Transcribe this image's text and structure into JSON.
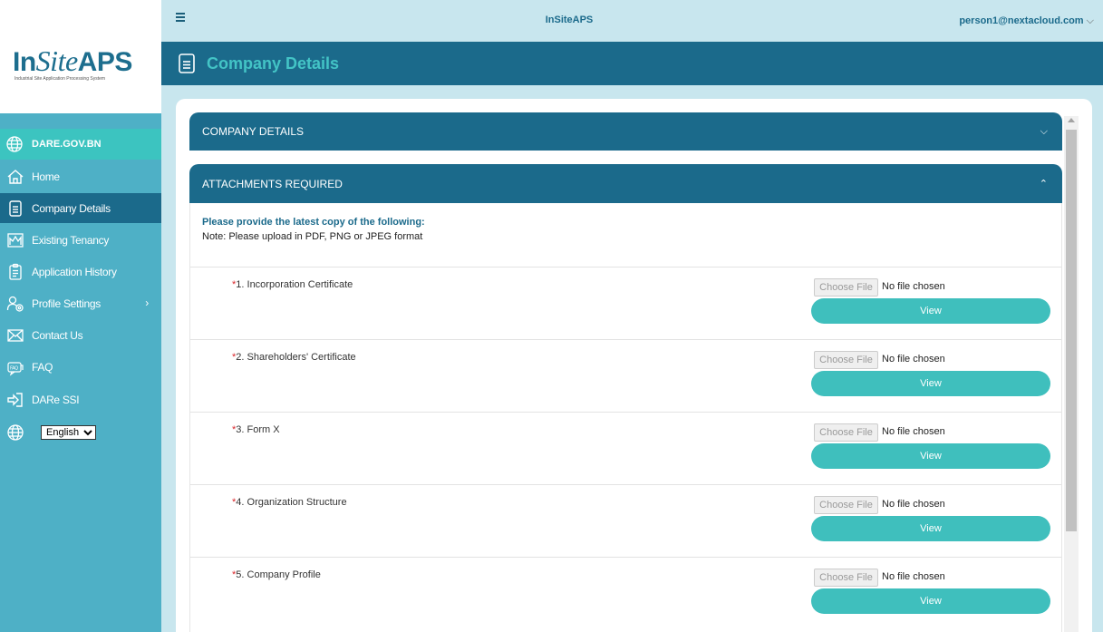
{
  "app": {
    "logo_in": "In",
    "logo_site": "Site",
    "logo_aps": "APS",
    "logo_subtitle": "Industrial Site Application Processing System",
    "top_title": "InSiteAPS",
    "user": "person1@nextacloud.com"
  },
  "sidebar": {
    "domain": "DARE.GOV.BN",
    "items": [
      {
        "label": "Home",
        "icon": "home-icon"
      },
      {
        "label": "Company Details",
        "icon": "document-icon"
      },
      {
        "label": "Existing Tenancy",
        "icon": "building-icon"
      },
      {
        "label": "Application History",
        "icon": "clipboard-icon"
      },
      {
        "label": "Profile Settings",
        "icon": "users-gear-icon"
      },
      {
        "label": "Contact Us",
        "icon": "envelope-icon"
      },
      {
        "label": "FAQ",
        "icon": "faq-icon"
      },
      {
        "label": "DARe SSI",
        "icon": "login-icon"
      }
    ],
    "language": {
      "selected": "English"
    }
  },
  "page": {
    "title": "Company Details"
  },
  "accordion": {
    "company_details": "COMPANY DETAILS",
    "attachments": "ATTACHMENTS REQUIRED"
  },
  "attachments": {
    "instruction_title": "Please provide the latest copy of the following:",
    "instruction_note": "Note: Please upload in PDF, PNG or JPEG format",
    "choose_file_label": "Choose File",
    "no_file_label": "No file chosen",
    "view_label": "View",
    "items": [
      {
        "required": "*",
        "label": "1. Incorporation Certificate"
      },
      {
        "required": "*",
        "label": "2. Shareholders' Certificate"
      },
      {
        "required": "*",
        "label": "3. Form X"
      },
      {
        "required": "*",
        "label": "4. Organization Structure"
      },
      {
        "required": "*",
        "label": "5. Company Profile"
      }
    ]
  },
  "colors": {
    "dark_teal": "#1b6a8b",
    "sidebar": "#4eb0c6",
    "accent": "#3fbfbd",
    "background": "#c8e6ee"
  }
}
